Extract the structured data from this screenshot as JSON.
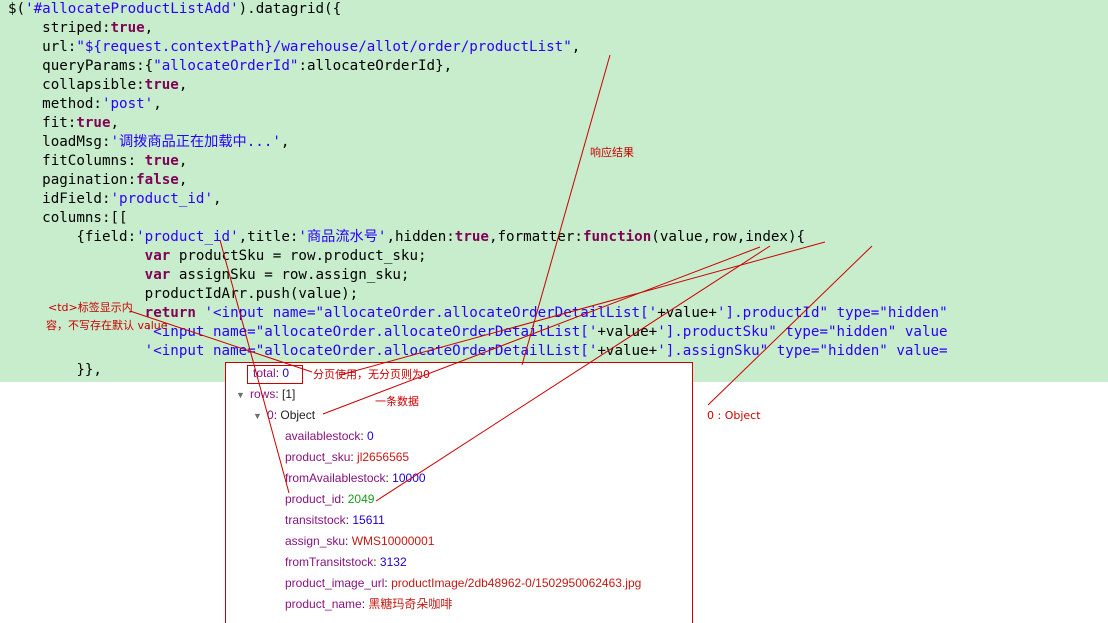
{
  "code": {
    "line1": {
      "a": "$(",
      "b": "'#allocateProductListAdd'",
      "c": ").datagrid({"
    },
    "line2": {
      "a": "    striped:",
      "b": "true",
      "c": ","
    },
    "line3": {
      "a": "    url:",
      "b": "\"${request.contextPath}/warehouse/allot/order/productList\"",
      "c": ","
    },
    "line4": {
      "a": "    queryParams:{",
      "b": "\"allocateOrderId\"",
      "c": ":allocateOrderId},"
    },
    "line5": {
      "a": "    collapsible:",
      "b": "true",
      "c": ","
    },
    "line6": {
      "a": "    method:",
      "b": "'post'",
      "c": ","
    },
    "line7": {
      "a": "    fit:",
      "b": "true",
      "c": ","
    },
    "line8": {
      "a": "    loadMsg:",
      "b": "'调拨商品正在加载中...'",
      "c": ","
    },
    "line9": {
      "a": "    fitColumns: ",
      "b": "true",
      "c": ","
    },
    "line10": {
      "a": "    pagination:",
      "b": "false",
      "c": ","
    },
    "line11": {
      "a": "    idField:",
      "b": "'product_id'",
      "c": ","
    },
    "line12": {
      "a": "    columns:[["
    },
    "line13": {
      "a": "        {field:",
      "b": "'product_id'",
      "c": ",title:",
      "d": "'商品流水号'",
      "e": ",hidden:",
      "f": "true",
      "g": ",formatter:",
      "h": "function",
      "i": "(value,row,index){"
    },
    "line14": {
      "a": "                ",
      "b": "var",
      "c": " productSku = row.product_sku;"
    },
    "line15": {
      "a": "                ",
      "b": "var",
      "c": " assignSku = row.assign_sku;"
    },
    "line16": {
      "a": "                productIdArr.push(value);"
    },
    "line17": {
      "a": "                ",
      "b": "return",
      "c": " ",
      "d": "'<input name=\"allocateOrder.allocateOrderDetailList['",
      "e": "+value+",
      "f": "'].productId\" type=\"hidden\""
    },
    "line18": {
      "a": "                ",
      "b": "'<input name=\"allocateOrder.allocateOrderDetailList['",
      "c": "+value+",
      "d": "'].productSku\" type=\"hidden\" value"
    },
    "line19": {
      "a": "                ",
      "b": "'<input name=\"allocateOrder.allocateOrderDetailList['",
      "c": "+value+",
      "d": "'].assignSku\" type=\"hidden\" value="
    },
    "line20": {
      "a": "        }},"
    }
  },
  "console": {
    "total_key": "total",
    "total_value": "0",
    "rows_key": "rows",
    "rows_value": "[1]",
    "item_key": "0",
    "item_type": "Object",
    "fields": [
      {
        "key": "availablestock",
        "value": "0",
        "kind": "number"
      },
      {
        "key": "product_sku",
        "value": "jl2656565",
        "kind": "string"
      },
      {
        "key": "fromAvailablestock",
        "value": "10000",
        "kind": "number"
      },
      {
        "key": "product_id",
        "value": "2049",
        "kind": "green"
      },
      {
        "key": "transitstock",
        "value": "15611",
        "kind": "number"
      },
      {
        "key": "assign_sku",
        "value": "WMS10000001",
        "kind": "string"
      },
      {
        "key": "fromTransitstock",
        "value": "3132",
        "kind": "number"
      },
      {
        "key": "product_image_url",
        "value": "productImage/2db48962-0/1502950062463.jpg",
        "kind": "string"
      },
      {
        "key": "product_name",
        "value": "黑糖玛奇朵咖啡",
        "kind": "string"
      }
    ]
  },
  "annotations": {
    "response_result": "响应结果",
    "td_note_1": "<td>标签显示内",
    "td_note_2": "容，不写存在默认 value",
    "pagination_note": "分页使用，无分页则为0",
    "one_record": "一条数据",
    "object_note": "0 : Object"
  },
  "colors": {
    "code_background": "#c7edcc",
    "annotation_red": "#cc0000",
    "string_blue": "#2a00ff",
    "keyword_purple": "#7f0055"
  }
}
